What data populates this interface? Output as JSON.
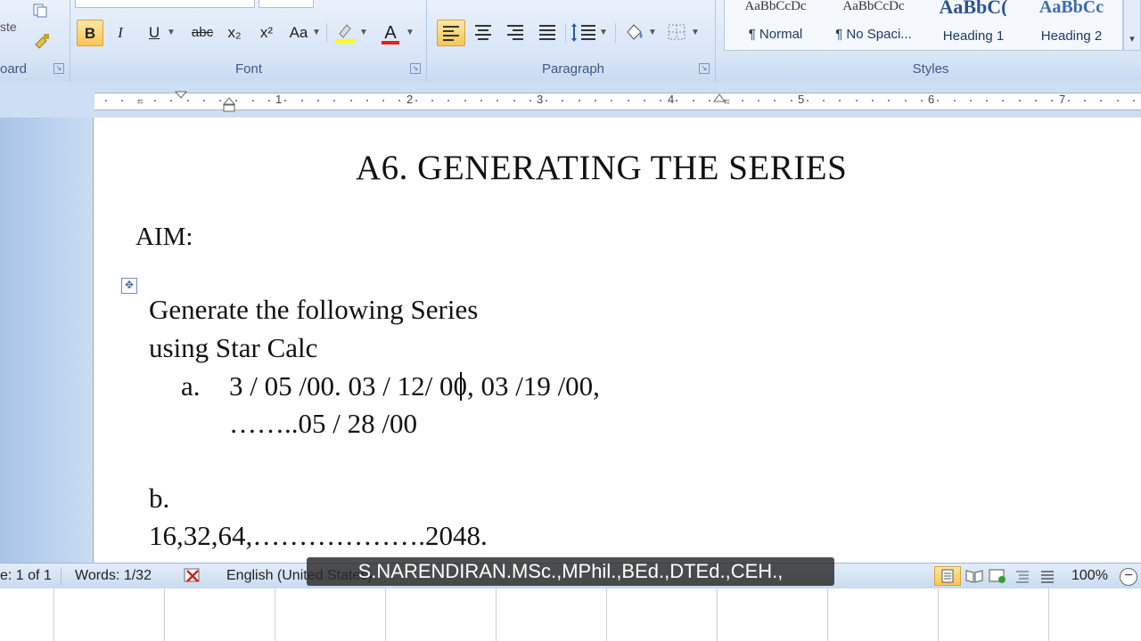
{
  "ribbon": {
    "clipboard": {
      "label_partial": "oard",
      "paste_partial": "ste"
    },
    "font": {
      "label": "Font",
      "bold": "B",
      "italic": "I",
      "underline": "U",
      "strike": "abc",
      "subscript": "x₂",
      "superscript": "x²",
      "change_case": "Aa",
      "font_color": "A"
    },
    "paragraph": {
      "label": "Paragraph"
    },
    "styles": {
      "label": "Styles",
      "items": [
        {
          "sample": "AaBbCcDc",
          "name": "¶ Normal"
        },
        {
          "sample": "AaBbCcDc",
          "name": "¶ No Spaci..."
        },
        {
          "sample": "AaBbC(",
          "name": "Heading 1"
        },
        {
          "sample": "AaBbCc",
          "name": "Heading 2"
        }
      ]
    }
  },
  "ruler": {
    "numbers": [
      "1",
      "2",
      "3",
      "4",
      "5",
      "6",
      "7"
    ]
  },
  "document": {
    "title": "A6. GENERATING THE SERIES",
    "aim": "AIM:",
    "line1": "Generate the following Series",
    "line2": "using Star Calc",
    "item_a_label": "a.",
    "item_a_line1": "3 / 05 /00. 03 / 12/ 00, 03 /19 /00,",
    "item_a_line2": "……..05 / 28 /00",
    "item_b_label": "b.",
    "item_b_line": "16,32,64,……………….2048."
  },
  "status": {
    "page": "e: 1 of 1",
    "words": "Words: 1/32",
    "language": "English (United States)",
    "zoom": "100%"
  },
  "caption": "S.NARENDIRAN.MSc.,MPhil.,BEd.,DTEd.,CEH.,",
  "colors": {
    "font_color_bar": "#e02020",
    "highlight_bar": "#ffff00",
    "caption_bg": "#282828"
  }
}
